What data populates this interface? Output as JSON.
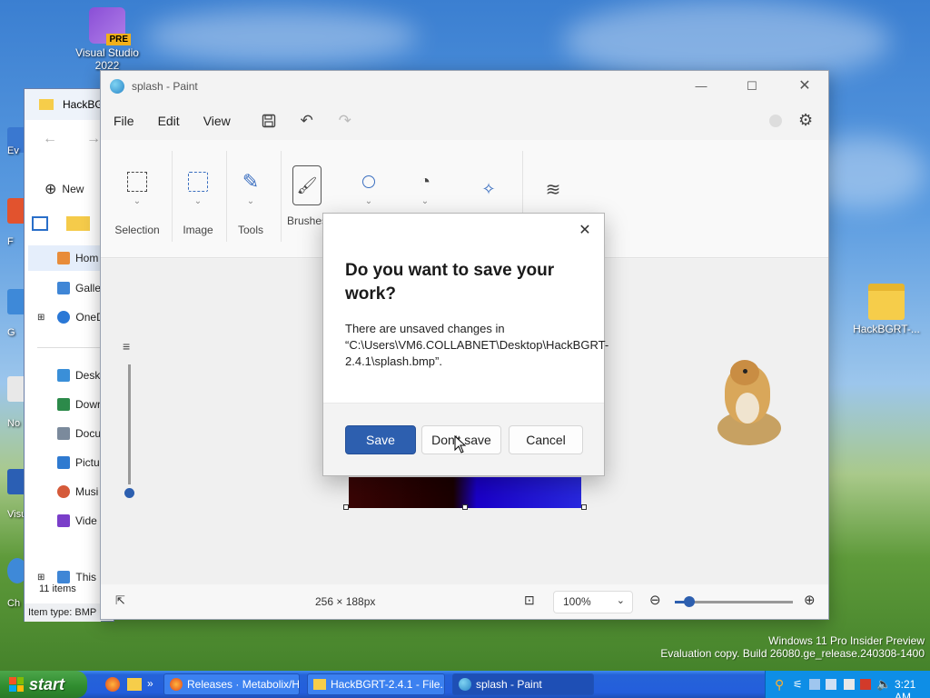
{
  "desktop": {
    "icons": [
      {
        "label": "Visual Studio 2022",
        "badge": "PRE"
      },
      {
        "label": "HackBGRT-..."
      }
    ],
    "partial_labels": [
      "Ev",
      "F",
      "G",
      "No",
      "Visu",
      "Ch"
    ]
  },
  "explorer": {
    "title": "HackBG",
    "new_label": "New",
    "nav": [
      "Hom",
      "Galle",
      "OneD",
      "Desk",
      "Dowr",
      "Docu",
      "Pictu",
      "Musi",
      "Vide",
      "This"
    ],
    "items_count": "11 items",
    "item_type": "Item type: BMP"
  },
  "paint": {
    "title": "splash - Paint",
    "menu": [
      "File",
      "Edit",
      "View"
    ],
    "ribbon_groups": [
      "Selection",
      "Image",
      "Tools",
      "Brushes"
    ],
    "image_size": "256 × 188px",
    "zoom": "100%",
    "zoom_level": 0.12
  },
  "dialog": {
    "heading": "Do you want to save your work?",
    "message": "There are unsaved changes in “C:\\Users\\VM6.COLLABNET\\Desktop\\HackBGRT-2.4.1\\splash.bmp”.",
    "save": "Save",
    "dont_save": "Don't save",
    "cancel": "Cancel"
  },
  "watermark": {
    "line1": "Windows 11 Pro Insider Preview",
    "line2": "Evaluation copy. Build 26080.ge_release.240308-1400"
  },
  "taskbar": {
    "start": "start",
    "tasks": [
      "Releases · Metabolix/H...",
      "HackBGRT-2.4.1 - File...",
      "splash - Paint"
    ],
    "clock": "3:21 AM"
  },
  "colors": {
    "accent": "#2d5faf",
    "taskbar": "#245edc",
    "start": "#2f8b2e"
  }
}
